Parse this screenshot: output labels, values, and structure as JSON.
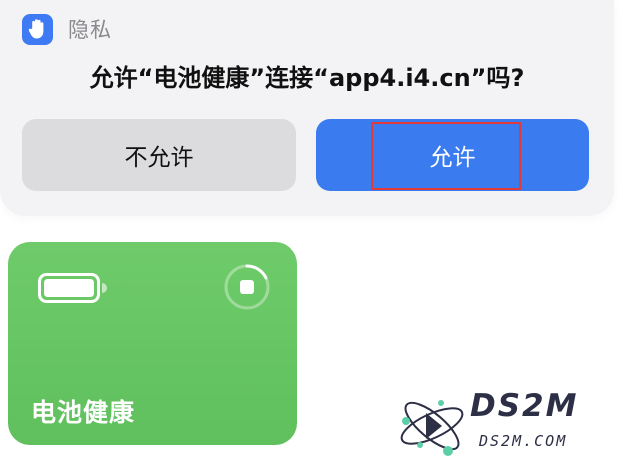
{
  "sheet": {
    "header_label": "隐私",
    "message": "允许“电池健康”连接“app4.i4.cn”吗?",
    "deny_label": "不允许",
    "allow_label": "允许"
  },
  "shortcut_card": {
    "title": "电池健康",
    "icon": "battery-icon",
    "control_icon": "stop-icon"
  },
  "watermark": {
    "brand": "DS2M",
    "domain": "DS2M.COM"
  },
  "colors": {
    "accent": "#3b7bf0",
    "card_green": "#66c563",
    "highlight": "#e23a3a",
    "deny_button": "#dcdcde"
  }
}
